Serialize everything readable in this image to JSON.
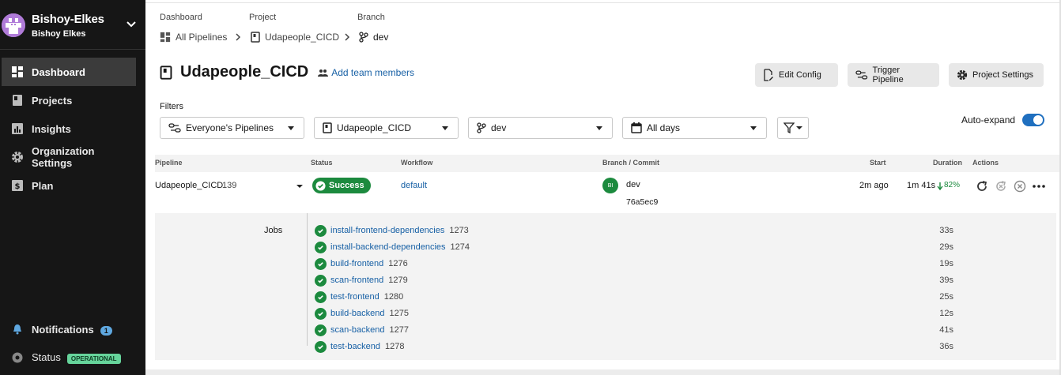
{
  "sidebar": {
    "org_name": "Bishoy-Elkes",
    "org_sub": "Bishoy Elkes",
    "items": [
      {
        "label": "Dashboard",
        "icon": "dashboard-icon"
      },
      {
        "label": "Projects",
        "icon": "projects-icon"
      },
      {
        "label": "Insights",
        "icon": "insights-icon"
      },
      {
        "label": "Organization Settings",
        "icon": "gear-icon"
      },
      {
        "label": "Plan",
        "icon": "plan-icon"
      }
    ],
    "notifications": {
      "label": "Notifications",
      "count": "1"
    },
    "status": {
      "label": "Status",
      "badge": "OPERATIONAL"
    }
  },
  "breadcrumb": {
    "dashboard_label": "Dashboard",
    "dashboard_value": "All Pipelines",
    "project_label": "Project",
    "project_value": "Udapeople_CICD",
    "branch_label": "Branch",
    "branch_value": "dev"
  },
  "header": {
    "title": "Udapeople_CICD",
    "add_team": "Add team members",
    "edit_config": "Edit Config",
    "trigger_pipeline": "Trigger Pipeline",
    "project_settings": "Project Settings"
  },
  "filters": {
    "label": "Filters",
    "pipelines": "Everyone's Pipelines",
    "project": "Udapeople_CICD",
    "branch": "dev",
    "days": "All days",
    "auto_expand": "Auto-expand"
  },
  "table": {
    "headers": [
      "Pipeline",
      "Status",
      "Workflow",
      "Branch / Commit",
      "Start",
      "Duration",
      "Actions"
    ],
    "row": {
      "pipeline": "Udapeople_CICD",
      "number": "139",
      "status": "Success",
      "workflow": "default",
      "avatar": "BI",
      "branch": "dev",
      "commit": "76a5ec9",
      "start": "2m ago",
      "duration": "1m 41s",
      "delta": "82%"
    },
    "jobs_label": "Jobs",
    "jobs": [
      {
        "name": "install-frontend-dependencies",
        "num": "1273",
        "dur": "33s"
      },
      {
        "name": "install-backend-dependencies",
        "num": "1274",
        "dur": "29s"
      },
      {
        "name": "build-frontend",
        "num": "1276",
        "dur": "19s"
      },
      {
        "name": "scan-frontend",
        "num": "1279",
        "dur": "39s"
      },
      {
        "name": "test-frontend",
        "num": "1280",
        "dur": "25s"
      },
      {
        "name": "build-backend",
        "num": "1275",
        "dur": "12s"
      },
      {
        "name": "scan-backend",
        "num": "1277",
        "dur": "41s"
      },
      {
        "name": "test-backend",
        "num": "1278",
        "dur": "36s"
      }
    ]
  },
  "colors": {
    "success": "#1c8a3e",
    "link": "#1760a5",
    "sidebar": "#161616"
  }
}
